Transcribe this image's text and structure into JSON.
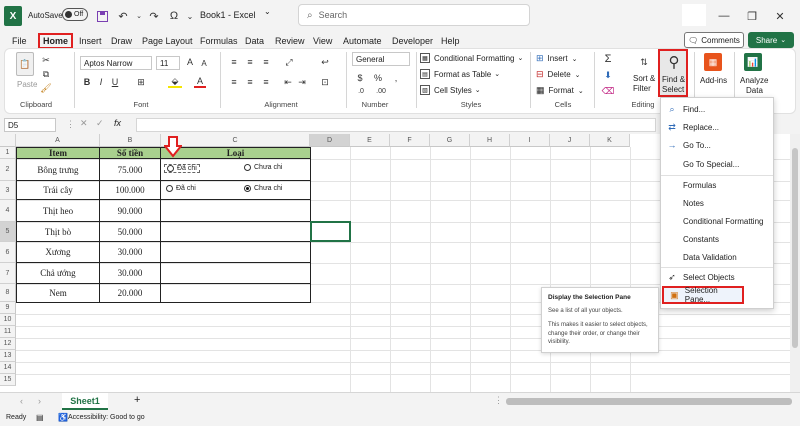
{
  "title_bar": {
    "autosave_label": "AutoSave",
    "autosave_state": "Off",
    "document_title": "Book1 - Excel",
    "search_placeholder": "Search"
  },
  "tabs": [
    "File",
    "Home",
    "Insert",
    "Draw",
    "Page Layout",
    "Formulas",
    "Data",
    "Review",
    "View",
    "Automate",
    "Developer",
    "Help"
  ],
  "ribbon_right": {
    "comments": "Comments",
    "share": "Share"
  },
  "ribbon": {
    "clipboard": {
      "paste": "Paste",
      "label": "Clipboard"
    },
    "font": {
      "name": "Aptos Narrow",
      "size": "11",
      "label": "Font"
    },
    "alignment": {
      "label": "Alignment"
    },
    "number": {
      "format": "General",
      "label": "Number"
    },
    "styles": {
      "conditional": "Conditional Formatting",
      "table": "Format as Table",
      "cell_styles": "Cell Styles",
      "label": "Styles"
    },
    "cells": {
      "insert": "Insert",
      "delete": "Delete",
      "format": "Format",
      "label": "Cells"
    },
    "editing": {
      "sort1": "Sort &",
      "sort2": "Filter",
      "find1": "Find &",
      "find2": "Select",
      "label": "Editing"
    },
    "addins": {
      "label": "Add-ins"
    },
    "analyze": {
      "label1": "Analyze",
      "label2": "Data"
    }
  },
  "formula_bar": {
    "name_box": "D5",
    "fx": "fx"
  },
  "columns": [
    "A",
    "B",
    "C",
    "D",
    "E",
    "F",
    "G",
    "H",
    "I",
    "J",
    "K"
  ],
  "rows": [
    "1",
    "2",
    "3",
    "4",
    "5",
    "6",
    "7",
    "8",
    "9",
    "10",
    "11",
    "12",
    "13",
    "14",
    "15"
  ],
  "table": {
    "headers": [
      "Item",
      "Số tiền",
      "Loại"
    ],
    "rows": [
      {
        "item": "Bông trưng",
        "amount": "75.000"
      },
      {
        "item": "Trái cây",
        "amount": "100.000"
      },
      {
        "item": "Thịt heo",
        "amount": "90.000"
      },
      {
        "item": "Thịt bò",
        "amount": "50.000"
      },
      {
        "item": "Xương",
        "amount": "30.000"
      },
      {
        "item": "Chả ướng",
        "amount": "30.000"
      },
      {
        "item": "Nem",
        "amount": "20.000"
      }
    ],
    "radio_paid": "Đã chi",
    "radio_unpaid": "Chưa chi"
  },
  "find_select_menu": [
    "Find...",
    "Replace...",
    "Go To...",
    "Go To Special...",
    "Formulas",
    "Notes",
    "Conditional Formatting",
    "Constants",
    "Data Validation",
    "Select Objects",
    "Selection Pane..."
  ],
  "tooltip": {
    "title": "Display the Selection Pane",
    "line1": "See a list of all your objects.",
    "line2": "This makes it easier to select objects, change their order, or change their visibility."
  },
  "sheet_tabs": {
    "sheet": "Sheet1",
    "add": "+"
  },
  "status_bar": {
    "ready": "Ready",
    "accessibility": "Accessibility: Good to go"
  },
  "colors": {
    "header_green": "#a9d08e",
    "highlight_red": "#e02020",
    "excel_green": "#217346"
  }
}
